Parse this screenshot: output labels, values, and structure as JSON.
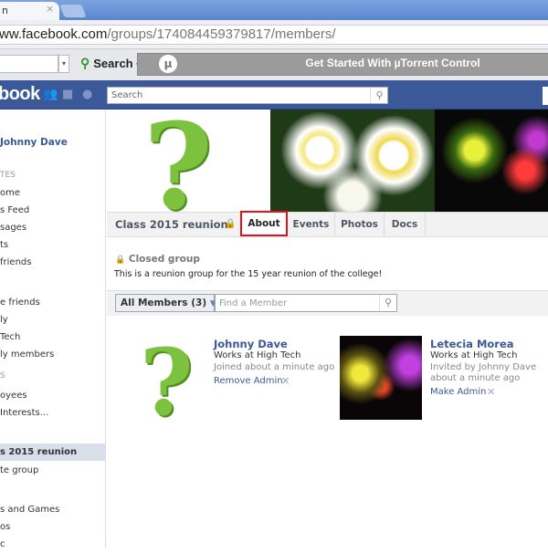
{
  "browser": {
    "tab_title": "n",
    "tab_close": "×",
    "url_host": "ww.facebook.com",
    "url_path": "/groups/174084459379817/members/"
  },
  "toolbar": {
    "search_label": "Search",
    "search_dropdown": "▾",
    "utorrent_text": "Get Started With µTorrent Control",
    "utorrent_logo": "µ"
  },
  "fb_header": {
    "logo": "book",
    "search_placeholder": "Search"
  },
  "sidebar": {
    "profile": "Johnny Dave",
    "items": [
      {
        "label": "TES",
        "type": "heading"
      },
      {
        "label": "ome"
      },
      {
        "label": "s Feed"
      },
      {
        "label": "sages"
      },
      {
        "label": "ts"
      },
      {
        "label": "friends"
      },
      {
        "label": "e friends"
      },
      {
        "label": "ly"
      },
      {
        "label": "Tech"
      },
      {
        "label": "ly members"
      },
      {
        "label": "S",
        "type": "heading"
      },
      {
        "label": "oyees"
      },
      {
        "label": "Interests..."
      },
      {
        "label": "s 2015 reunion",
        "active": true
      },
      {
        "label": "te group"
      },
      {
        "label": "s and Games"
      },
      {
        "label": "os"
      },
      {
        "label": "c"
      }
    ]
  },
  "group": {
    "name": "Class 2015 reunion",
    "tabs": [
      {
        "label": "About",
        "highlighted": true
      },
      {
        "label": "Events"
      },
      {
        "label": "Photos"
      },
      {
        "label": "Docs"
      }
    ],
    "privacy": "Closed group",
    "description": "This is a reunion group for the 15 year reunion of the college!"
  },
  "members_filter": {
    "label": "All Members",
    "count": "(3)",
    "find_placeholder": "Find a Member"
  },
  "members": [
    {
      "name": "Johnny Dave",
      "work": "Works at High Tech",
      "status": "Joined about a minute ago",
      "status2": "",
      "action": "Remove Admin",
      "remove": "✕"
    },
    {
      "name": "Letecia Morea",
      "work": "Works at High Tech",
      "status": "Invited by Johnny Dave",
      "status2": "about a minute ago",
      "action": "Make Admin",
      "remove": "✕"
    }
  ],
  "colors": {
    "facebook_blue": "#3b5998",
    "highlight_box": "#e0141e"
  }
}
